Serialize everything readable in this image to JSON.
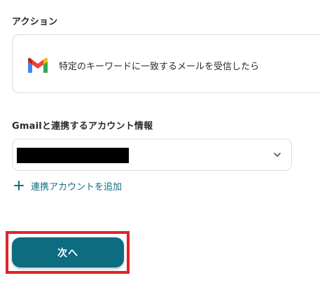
{
  "action": {
    "label": "アクション",
    "icon": "gmail-icon",
    "text": "特定のキーワードに一致するメールを受信したら"
  },
  "account": {
    "label": "Gmailと連携するアカウント情報",
    "selected_value": "",
    "add_link": "連携アカウントを追加"
  },
  "footer": {
    "next_label": "次へ"
  },
  "colors": {
    "accent": "#0e6c81",
    "link": "#0f6e80",
    "highlight": "#e0242b",
    "border": "#d9dde2"
  }
}
